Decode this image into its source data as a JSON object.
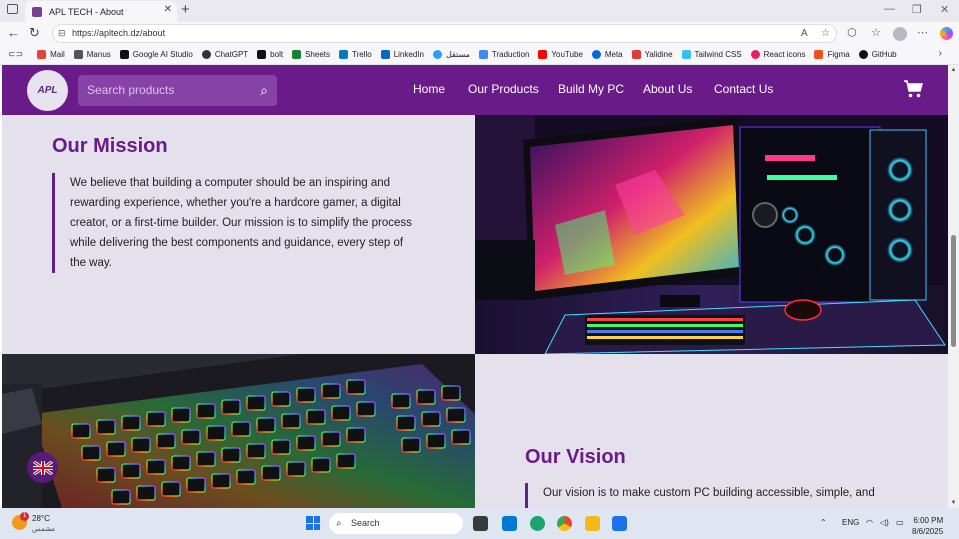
{
  "browser": {
    "tab_title": "APL TECH - About",
    "url": "https://apltech.dz/about",
    "bookmarks": [
      "Mail",
      "Manus",
      "Google AI Studio",
      "ChatGPT",
      "bolt",
      "Sheets",
      "Trello",
      "LinkedIn",
      "مستقل",
      "Traduction",
      "YouTube",
      "Meta",
      "Yalidine",
      "Tailwind CSS",
      "React icons",
      "Figma",
      "GitHub"
    ]
  },
  "site": {
    "logo_text": "APL",
    "search_placeholder": "Search products",
    "nav": [
      "Home",
      "Our Products",
      "Build My PC",
      "About Us",
      "Contact Us"
    ],
    "accent_color": "#6a1b8a"
  },
  "mission": {
    "title": "Our Mission",
    "text": "We believe that building a computer should be an inspiring and rewarding experience, whether you're a hardcore gamer, a digital creator, or a first-time builder. Our mission is to simplify the process while delivering the best components and guidance, every step of the way."
  },
  "vision": {
    "title": "Our Vision",
    "text": "Our vision is to make custom PC building accessible, simple, and"
  },
  "taskbar": {
    "temperature": "28°C",
    "weather_desc": "مشمس",
    "weather_badge": "1",
    "search_label": "Search",
    "language": "ENG",
    "time": "6:00 PM",
    "date": "8/6/2025"
  }
}
